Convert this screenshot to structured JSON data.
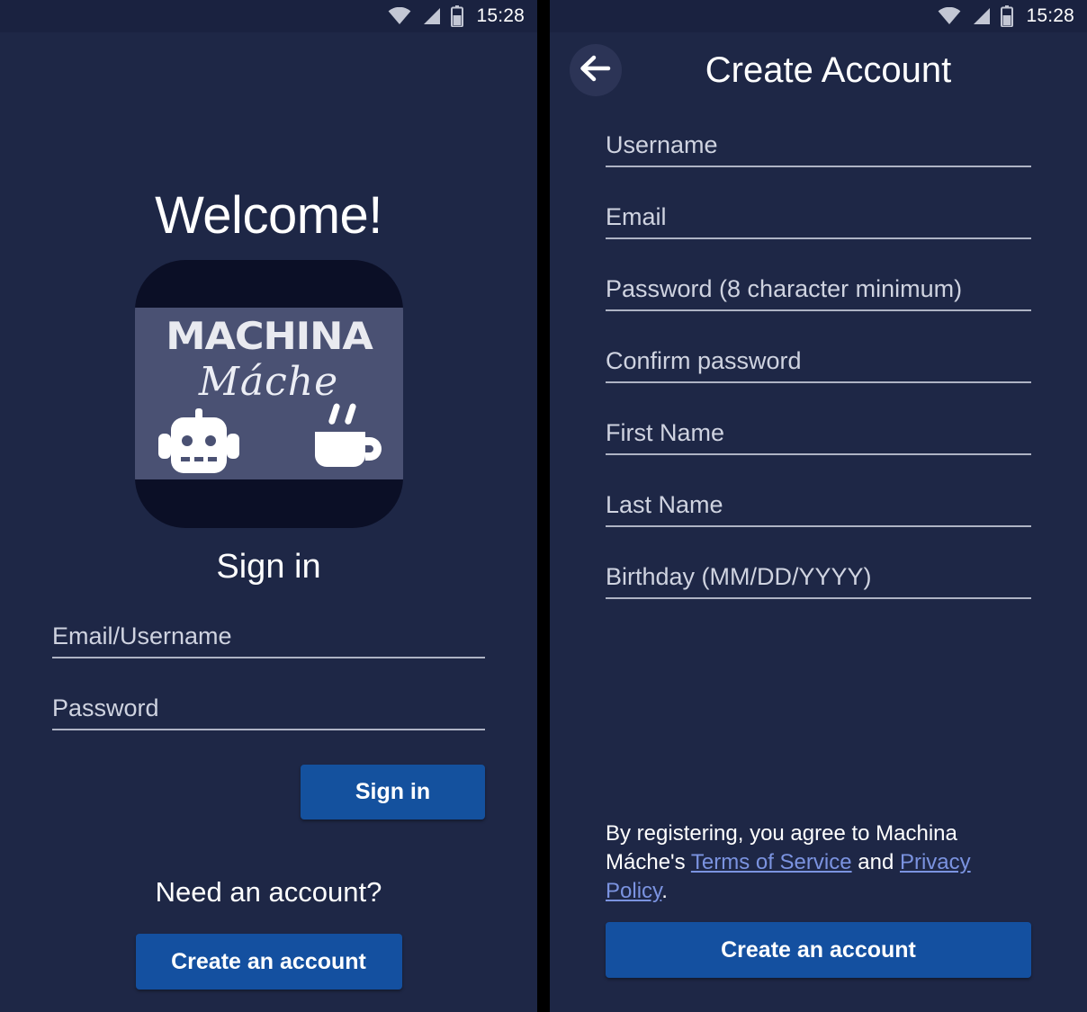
{
  "status_bar": {
    "time": "15:28",
    "icons": [
      "wifi-icon",
      "cell-signal-icon",
      "battery-icon"
    ],
    "battery_level_pct": 60
  },
  "colors": {
    "background": "#1e2746",
    "status_bar": "#1a2240",
    "button_blue": "#14519e",
    "create_button_blue": "#1450a0",
    "link_blue": "#7b93e0",
    "field_underline": "#aeb3c4",
    "logo_dark": "#0b0f26",
    "logo_band": "#4a5173",
    "back_circle": "#2c3456"
  },
  "sign_in_screen": {
    "welcome_heading": "Welcome!",
    "logo": {
      "wordmark": "MACHINA",
      "script": "Máche",
      "icons": [
        "robot-head-icon",
        "coffee-cup-icon"
      ]
    },
    "section_heading": "Sign in",
    "fields": [
      {
        "name": "email-username-field",
        "placeholder": "Email/Username",
        "value": ""
      },
      {
        "name": "password-field",
        "placeholder": "Password",
        "value": ""
      }
    ],
    "sign_in_button": "Sign in",
    "need_account_text": "Need an account?",
    "create_account_button": "Create an account"
  },
  "create_account_screen": {
    "back_icon": "arrow-left-icon",
    "title": "Create Account",
    "fields": [
      {
        "name": "username-field",
        "placeholder": "Username",
        "value": ""
      },
      {
        "name": "email-field",
        "placeholder": "Email",
        "value": ""
      },
      {
        "name": "password-field",
        "placeholder": "Password (8 character minimum)",
        "value": ""
      },
      {
        "name": "confirm-password-field",
        "placeholder": "Confirm password",
        "value": ""
      },
      {
        "name": "first-name-field",
        "placeholder": "First Name",
        "value": ""
      },
      {
        "name": "last-name-field",
        "placeholder": "Last Name",
        "value": ""
      },
      {
        "name": "birthday-field",
        "placeholder": "Birthday (MM/DD/YYYY)",
        "value": ""
      }
    ],
    "legal": {
      "prefix": "By registering, you agree to Machina Máche's ",
      "terms_link": "Terms of Service",
      "conjunction": " and ",
      "privacy_link": "Privacy Policy",
      "suffix": "."
    },
    "create_account_button": "Create an account"
  }
}
